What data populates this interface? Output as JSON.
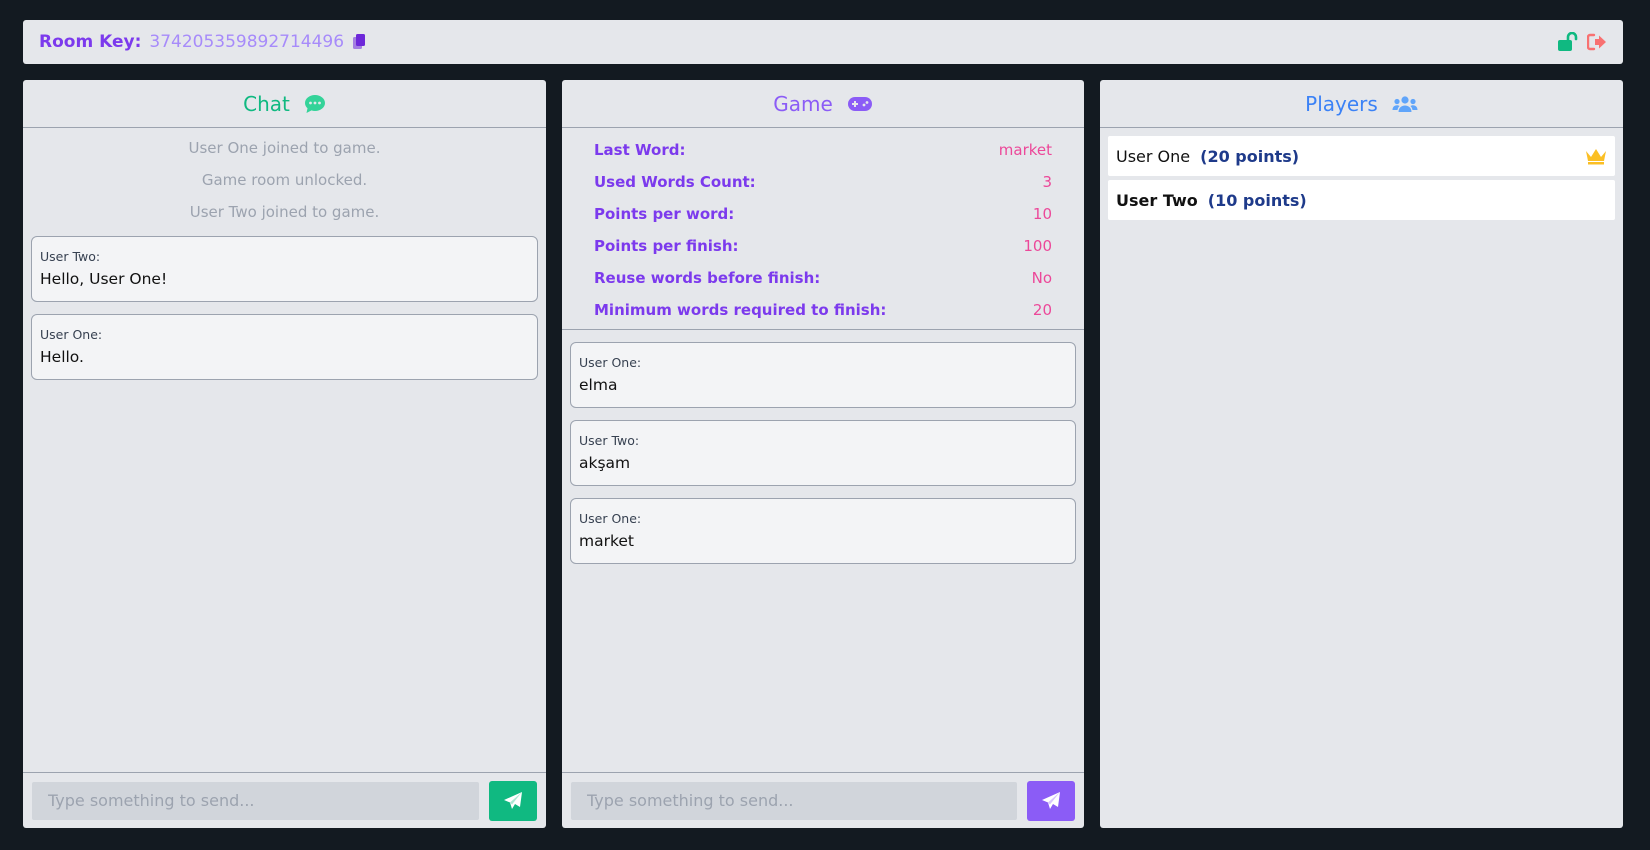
{
  "topbar": {
    "room_key_label": "Room Key:",
    "room_key_value": "374205359892714496",
    "copy_icon": "copy-icon",
    "unlock_icon": "unlock-icon",
    "exit_icon": "exit-icon",
    "colors": {
      "unlock": "#10b981",
      "exit": "#f87171"
    }
  },
  "chat": {
    "title": "Chat",
    "icon": "comment-icon",
    "system_messages": [
      "User One joined to game.",
      "Game room unlocked.",
      "User Two joined to game."
    ],
    "messages": [
      {
        "user": "User Two:",
        "text": "Hello, User One!"
      },
      {
        "user": "User One:",
        "text": "Hello."
      }
    ],
    "input_placeholder": "Type something to send...",
    "accent": "#10b981"
  },
  "game": {
    "title": "Game",
    "icon": "gamepad-icon",
    "stats": [
      {
        "label": "Last Word:",
        "value": "market"
      },
      {
        "label": "Used Words Count:",
        "value": "3"
      },
      {
        "label": "Points per word:",
        "value": "10"
      },
      {
        "label": "Points per finish:",
        "value": "100"
      },
      {
        "label": "Reuse words before finish:",
        "value": "No"
      },
      {
        "label": "Minimum words required to finish:",
        "value": "20"
      }
    ],
    "words": [
      {
        "user": "User One:",
        "text": "elma"
      },
      {
        "user": "User Two:",
        "text": "akşam"
      },
      {
        "user": "User One:",
        "text": "market"
      }
    ],
    "input_placeholder": "Type something to send...",
    "accent": "#8b5cf6"
  },
  "players": {
    "title": "Players",
    "icon": "users-icon",
    "list": [
      {
        "name": "User One",
        "points": "(20 points)",
        "leader": true
      },
      {
        "name": "User Two",
        "points": "(10 points)",
        "leader": false
      }
    ],
    "accent": "#3b82f6"
  }
}
